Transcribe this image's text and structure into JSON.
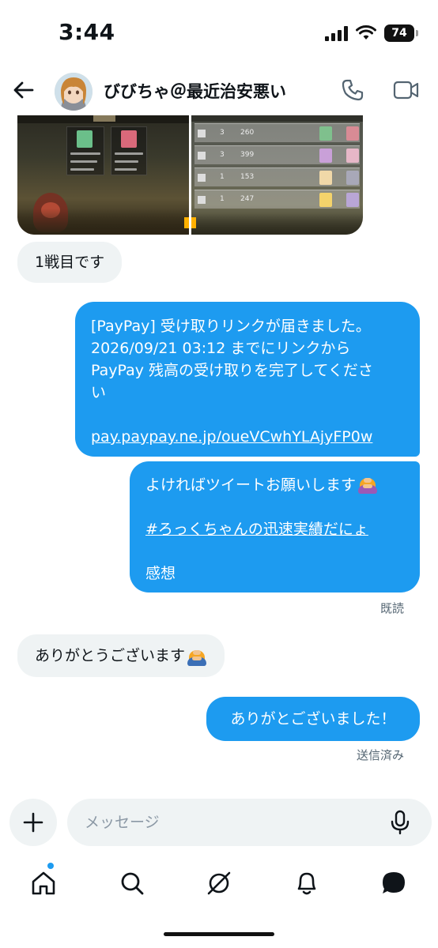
{
  "status_bar": {
    "time": "3:44",
    "battery": "74"
  },
  "header": {
    "name": "びびちゃ＠最近治安悪い"
  },
  "messages": {
    "m1": "1戦目です",
    "m2": {
      "line1": "[PayPay] 受け取りリンクが届きました。",
      "line2": "2026/09/21 03:12 までにリンクから",
      "line3": "PayPay 残高の受け取りを完了してくださ",
      "line4": "い",
      "link": "pay.paypay.ne.jp/oueVCwhYLAjyFP0w"
    },
    "m3": {
      "line1": "よければツイートお願いします",
      "hashtag": "#ろっくちゃんの迅速実績だにょ",
      "line3": "感想"
    },
    "read_label": "既読",
    "m4": "ありがとうございます",
    "m5": "ありがとございました！",
    "sent_label": "送信済み"
  },
  "composer": {
    "placeholder": "メッセージ"
  },
  "icons": {
    "back": "arrow-left-icon",
    "call": "phone-icon",
    "video": "video-camera-icon",
    "plus": "plus-icon",
    "mic": "microphone-icon",
    "home": "home-icon",
    "search": "search-icon",
    "grok": "grok-icon",
    "notifications": "bell-icon",
    "messages": "messages-icon",
    "emoji_bow": "person-bowing-emoji",
    "emoji_bow_blue": "person-bowing-emoji"
  },
  "colors": {
    "accent": "#1d9bf0",
    "incoming_bubble": "#eff3f4",
    "meta_text": "#536471"
  }
}
